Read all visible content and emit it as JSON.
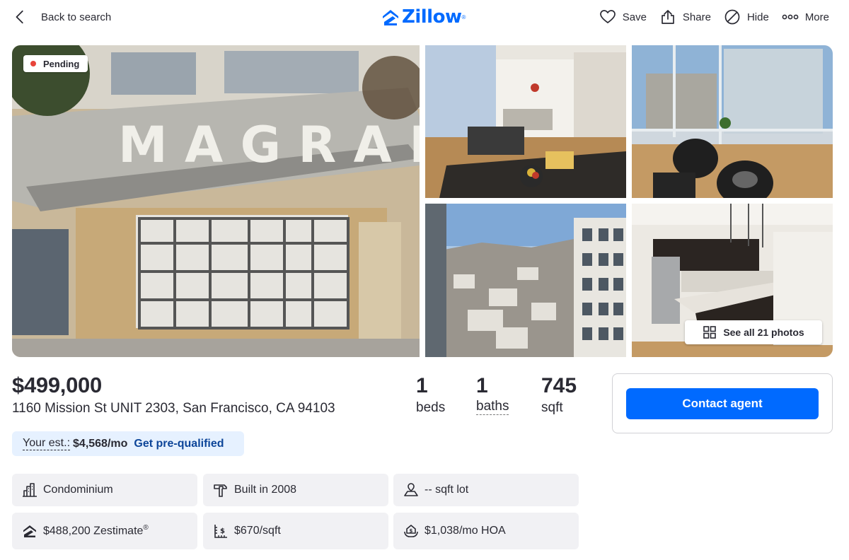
{
  "header": {
    "back_label": "Back to search",
    "logo_text": "Zillow",
    "logo_mark": "®",
    "actions": [
      {
        "label": "Save",
        "icon": "heart-icon"
      },
      {
        "label": "Share",
        "icon": "share-icon"
      },
      {
        "label": "Hide",
        "icon": "hide-icon"
      },
      {
        "label": "More",
        "icon": "more-icon"
      }
    ]
  },
  "gallery": {
    "status_badge": "Pending",
    "see_all_label": "See all 21 photos",
    "photos": [
      "building-entrance-photo",
      "living-room-photo",
      "window-chairs-photo",
      "city-view-photo",
      "kitchen-photo"
    ]
  },
  "listing": {
    "price": "$499,000",
    "address": "1160 Mission St UNIT 2303, San Francisco, CA 94103",
    "beds_num": "1",
    "beds_label": "beds",
    "baths_num": "1",
    "baths_label": "baths",
    "sqft_num": "745",
    "sqft_label": "sqft"
  },
  "contact": {
    "button_label": "Contact agent"
  },
  "estimate": {
    "label": "Your est.:",
    "value": "$4,568/mo",
    "link": "Get pre-qualified"
  },
  "facts": {
    "type": "Condominium",
    "built": "Built in 2008",
    "lot": "-- sqft lot",
    "zestimate": "$488,200 Zestimate",
    "zestimate_mark": "®",
    "price_per_sqft": "$670/sqft",
    "hoa": "$1,038/mo HOA"
  },
  "colors": {
    "brand": "#006aff",
    "pending_dot": "#e8443a",
    "estimate_bg": "#e6f1ff",
    "fact_bg": "#f1f1f4"
  }
}
